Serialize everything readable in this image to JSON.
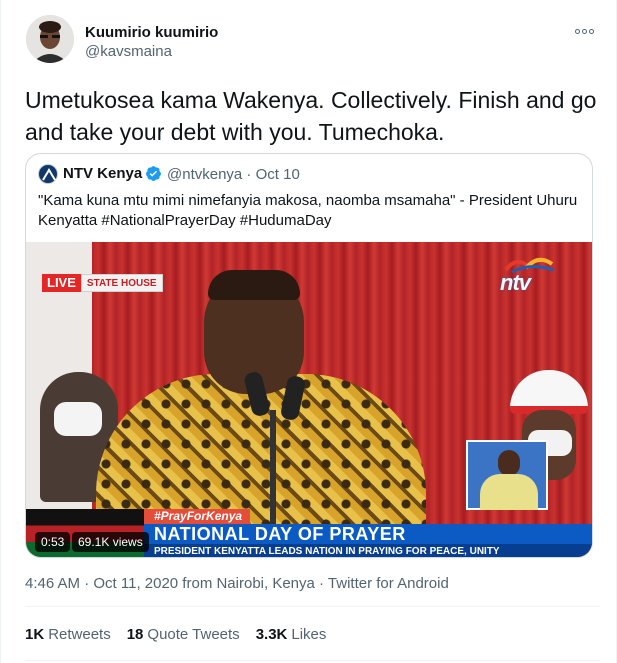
{
  "author": {
    "display_name": "Kuumirio kuumirio",
    "handle": "@kavsmaina"
  },
  "tweet": {
    "text": "Umetukosea kama Wakenya. Collectively. Finish and go and take your debt with you. Tumechoka.",
    "timestamp": "4:46 AM · Oct 11, 2020 from Nairobi, Kenya · Twitter for Android"
  },
  "quoted_tweet": {
    "display_name": "NTV Kenya",
    "meta": "@ntvkenya · Oct 10",
    "text": "\"Kama kuna mtu mimi nimefanyia makosa, naomba msamaha\" - President Uhuru Kenyatta #NationalPrayerDay #HudumaDay",
    "video": {
      "live_label": "LIVE",
      "location_label": "STATE HOUSE",
      "channel_logo": "ntv",
      "hashtag": "#PrayForKenya",
      "headline": "NATIONAL DAY OF PRAYER",
      "subheadline": "PRESIDENT KENYATTA LEADS NATION IN PRAYING FOR PEACE, UNITY",
      "duration": "0:53",
      "views": "69.1K views"
    }
  },
  "stats": {
    "retweets_count": "1K",
    "retweets_label": "Retweets",
    "quotes_count": "18",
    "quotes_label": "Quote Tweets",
    "likes_count": "3.3K",
    "likes_label": "Likes"
  },
  "colors": {
    "secondary_text": "#536471",
    "verified_badge": "#1d9bf0",
    "border": "#cfd9de"
  },
  "icons": [
    "more-options-icon",
    "verified-badge-icon",
    "ntv-avatar-icon"
  ]
}
